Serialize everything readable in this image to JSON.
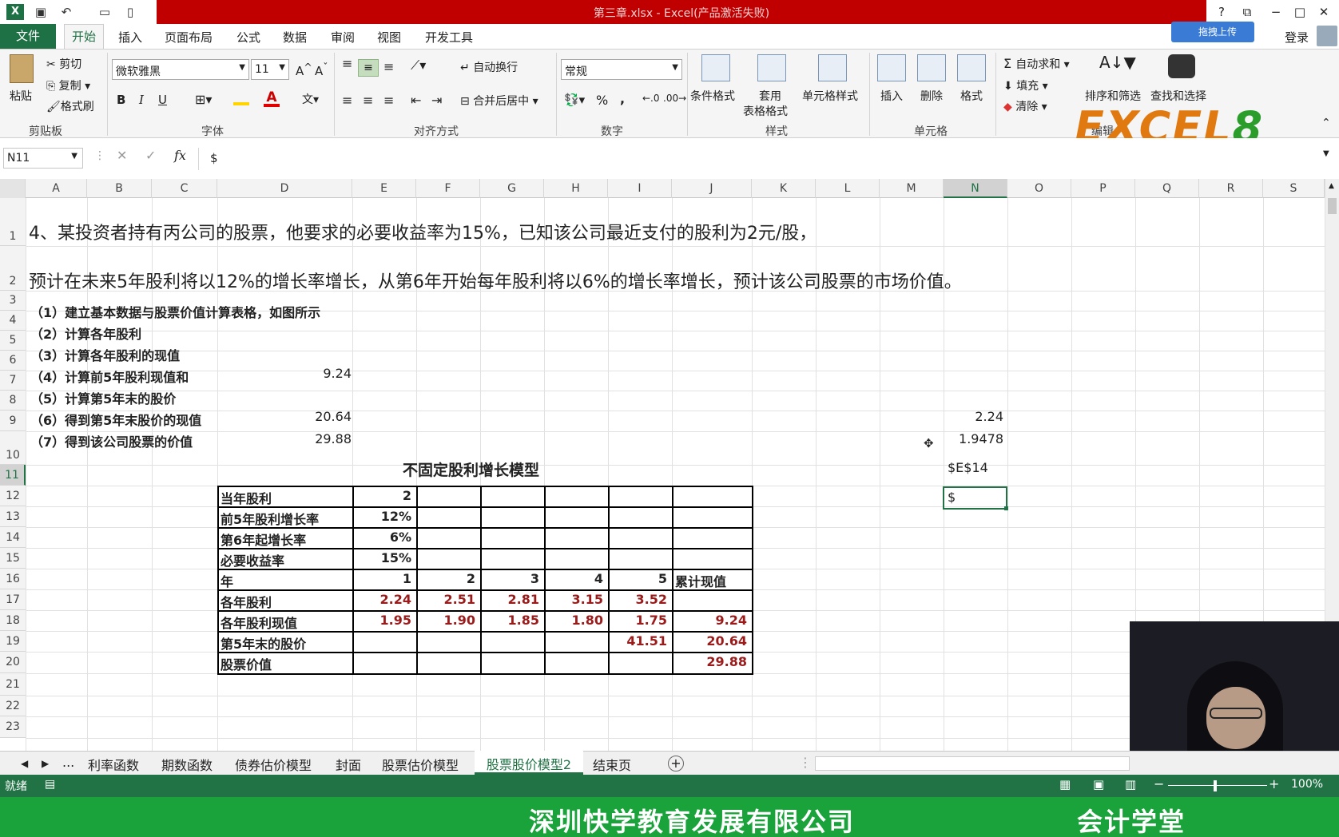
{
  "window": {
    "title": "第三章.xlsx - Excel(产品激活失败)",
    "login": "登录",
    "cloud_button": "拖拽上传",
    "help": "?"
  },
  "tabs": [
    "文件",
    "开始",
    "插入",
    "页面布局",
    "公式",
    "数据",
    "审阅",
    "视图",
    "开发工具"
  ],
  "ribbon": {
    "clipboard": {
      "paste": "粘贴",
      "cut": "剪切",
      "copy": "复制",
      "format_painter": "格式刷",
      "group": "剪贴板"
    },
    "font": {
      "name": "微软雅黑",
      "size": "11",
      "group": "字体",
      "bold": "B",
      "italic": "I",
      "underline": "U"
    },
    "alignment": {
      "wrap": "自动换行",
      "merge": "合并后居中",
      "group": "对齐方式"
    },
    "number": {
      "format": "常规",
      "percent": "%",
      "comma": ",",
      "group": "数字"
    },
    "styles": {
      "conditional": "条件格式",
      "table_1": "套用",
      "table_2": "表格格式",
      "cell_styles": "单元格样式",
      "group": "样式"
    },
    "cells": {
      "insert": "插入",
      "delete": "删除",
      "format": "格式",
      "group": "单元格"
    },
    "editing": {
      "autosum": "自动求和",
      "fill": "填充",
      "clear": "清除",
      "sort": "排序和筛选",
      "find": "查找和选择",
      "group": "编辑"
    }
  },
  "logo": {
    "part1": "EXCEL",
    "part2": "8"
  },
  "formula_bar": {
    "name_box": "N11",
    "content": "$",
    "fx": "fx"
  },
  "columns": [
    "A",
    "B",
    "C",
    "D",
    "E",
    "F",
    "G",
    "H",
    "I",
    "J",
    "K",
    "L",
    "M",
    "N",
    "O",
    "P",
    "Q",
    "R",
    "S"
  ],
  "rows": [
    "1",
    "2",
    "3",
    "4",
    "5",
    "6",
    "7",
    "8",
    "9",
    "10",
    "11",
    "12",
    "13",
    "14",
    "15",
    "16",
    "17",
    "18",
    "19",
    "20",
    "21",
    "22",
    "23"
  ],
  "sheet": {
    "line1": "4、某投资者持有丙公司的股票，他要求的必要收益率为15%，已知该公司最近支付的股利为2元/股，",
    "line2": "预计在未来5年股利将以12%的增长率增长，从第6年开始每年股利将以6%的增长率增长，预计该公司股票的市场价值。",
    "steps": [
      "（1）建立基本数据与股票价值计算表格，如图所示",
      "（2）计算各年股利",
      "（3）计算各年股利的现值",
      "（4）计算前5年股利现值和",
      "（5）计算第5年末的股价",
      "（6）得到第5年末股价的现值",
      "（7）得到该公司股票的价值"
    ],
    "d6": "9.24",
    "d8": "20.64",
    "d9": "29.88",
    "n8": "2.24",
    "n9": "1.9478",
    "n10": "$E$14",
    "n11": "$",
    "table_title": "不固定股利增长模型",
    "labels": [
      "当年股利",
      "前5年股利增长率",
      "第6年起增长率",
      "必要收益率",
      "年",
      "各年股利",
      "各年股利现值",
      "第5年末的股价",
      "股票价值"
    ],
    "e11": "2",
    "e12": "12%",
    "e13": "6%",
    "e14": "15%",
    "years": [
      "1",
      "2",
      "3",
      "4",
      "5"
    ],
    "cum_header": "累计现值",
    "dividends": [
      "2.24",
      "2.51",
      "2.81",
      "3.15",
      "3.52"
    ],
    "pv": [
      "1.95",
      "1.90",
      "1.85",
      "1.80",
      "1.75"
    ],
    "pv_total": "9.24",
    "i18": "41.51",
    "j18": "20.64",
    "j19": "29.88"
  },
  "sheet_tabs": [
    "...",
    "利率函数",
    "期数函数",
    "债券估价模型",
    "封面",
    "股票估价模型",
    "股票股价模型2",
    "结束页"
  ],
  "active_sheet": "股票股价模型2",
  "status": {
    "ready": "就绪",
    "zoom": "100%"
  },
  "footer": {
    "company": "深圳快学教育发展有限公司",
    "brand": "会计学堂"
  }
}
